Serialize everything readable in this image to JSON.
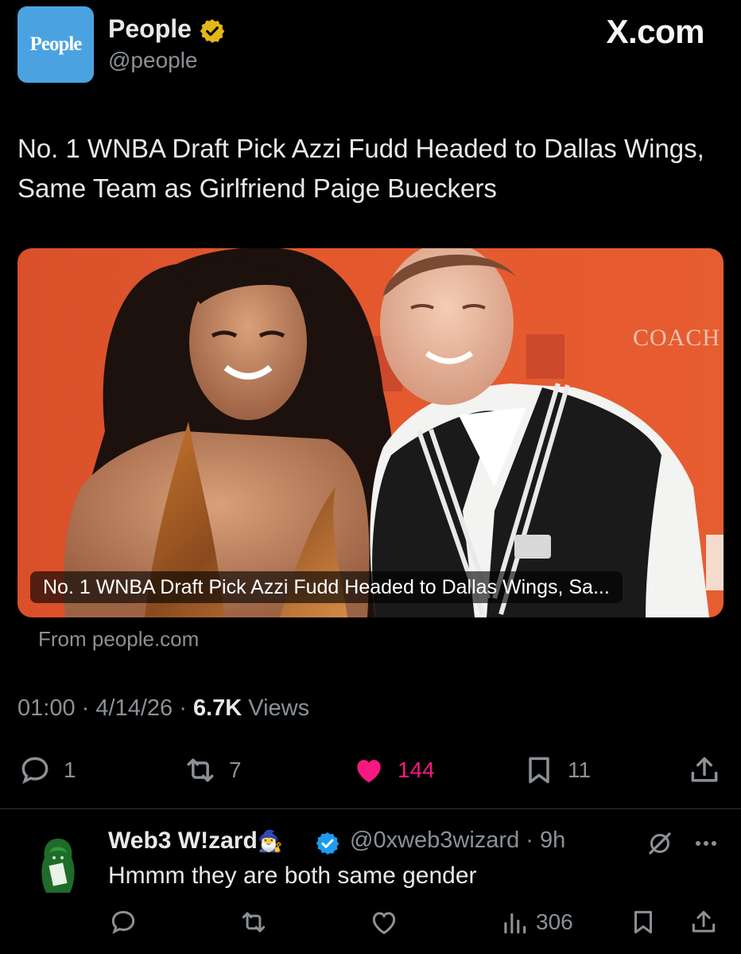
{
  "header": {
    "avatar_text": "People",
    "name": "People",
    "handle": "@people",
    "watermark": "X.com"
  },
  "tweet": {
    "text": "No. 1 WNBA Draft Pick Azzi Fudd Headed to Dallas Wings, Same Team as Girlfriend Paige Bueckers",
    "card": {
      "caption": "No. 1 WNBA Draft Pick Azzi Fudd Headed to Dallas Wings, Sa...",
      "backdrop_text": "COACH",
      "source": "From people.com"
    },
    "meta": {
      "time": "01:00",
      "date": "4/14/26",
      "views_count": "6.7K",
      "views_label": "Views",
      "sep": "·"
    },
    "actions": {
      "replies": "1",
      "reposts": "7",
      "likes": "144",
      "bookmarks": "11"
    }
  },
  "reply": {
    "name": "Web3 W!zard",
    "emoji": "🧙‍♂️",
    "handle": "@0xweb3wizard",
    "time": "· 9h",
    "text": "Hmmm they are both same gender",
    "views": "306"
  },
  "colors": {
    "background": "#000000",
    "text": "#e7e9ea",
    "muted": "#8b9196",
    "like": "#f91880",
    "verified_blue": "#1d9bf0",
    "verified_gold": "#e2b719",
    "avatar_blue": "#4aa3e0",
    "card_orange": "#e4582e"
  },
  "icons": [
    "verified-gold-badge",
    "reply-icon",
    "repost-icon",
    "heart-filled-icon",
    "bookmark-icon",
    "share-icon",
    "verified-blue-badge",
    "grok-icon",
    "more-icon",
    "views-icon",
    "heart-outline-icon"
  ]
}
